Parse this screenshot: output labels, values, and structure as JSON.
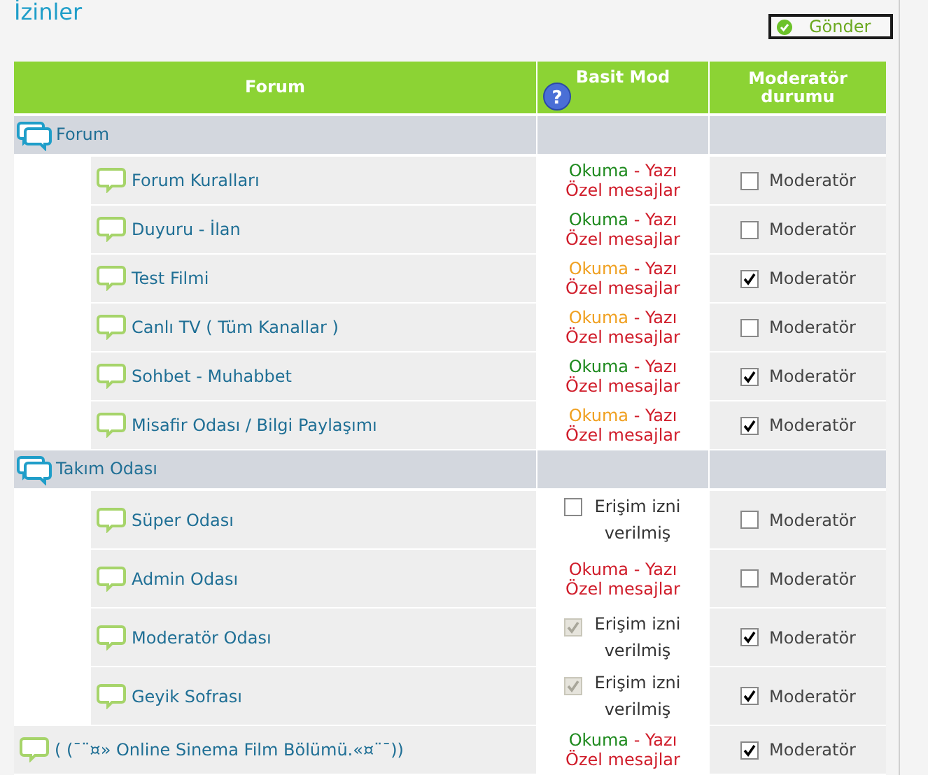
{
  "page_title": "İzinler",
  "submit_button": {
    "label": "Gönder"
  },
  "table": {
    "columns": [
      {
        "label": "Forum"
      },
      {
        "label": "Basit Mod",
        "help": "?"
      },
      {
        "label": "Moderatör durumu"
      }
    ],
    "rows": [
      {
        "kind": "category",
        "name": "Forum",
        "children": [
          {
            "name": "Forum Kuralları",
            "perm": {
              "kind": "rw",
              "read": "Okuma",
              "sep": "-",
              "write": "Yazı",
              "pm": "Özel mesajlar",
              "color": "#1e8a1e"
            },
            "mod": {
              "label": "Moderatör",
              "checked": false
            }
          },
          {
            "name": "Duyuru - İlan",
            "perm": {
              "kind": "rw",
              "read": "Okuma",
              "sep": "-",
              "write": "Yazı",
              "pm": "Özel mesajlar",
              "color": "#1e8a1e"
            },
            "mod": {
              "label": "Moderatör",
              "checked": false
            }
          },
          {
            "name": "Test Filmi",
            "perm": {
              "kind": "rw",
              "read": "Okuma",
              "sep": "-",
              "write": "Yazı",
              "pm": "Özel mesajlar",
              "color": "#f0a020"
            },
            "mod": {
              "label": "Moderatör",
              "checked": true
            }
          },
          {
            "name": "Canlı TV ( Tüm Kanallar )",
            "perm": {
              "kind": "rw",
              "read": "Okuma",
              "sep": "-",
              "write": "Yazı",
              "pm": "Özel mesajlar",
              "color": "#f0a020"
            },
            "mod": {
              "label": "Moderatör",
              "checked": false
            }
          },
          {
            "name": "Sohbet - Muhabbet",
            "perm": {
              "kind": "rw",
              "read": "Okuma",
              "sep": "-",
              "write": "Yazı",
              "pm": "Özel mesajlar",
              "color": "#1e8a1e"
            },
            "mod": {
              "label": "Moderatör",
              "checked": true
            }
          },
          {
            "name": "Misafir Odası / Bilgi Paylaşımı",
            "perm": {
              "kind": "rw",
              "read": "Okuma",
              "sep": "-",
              "write": "Yazı",
              "pm": "Özel mesajlar",
              "color": "#f0a020"
            },
            "mod": {
              "label": "Moderatör",
              "checked": true
            }
          }
        ]
      },
      {
        "kind": "category",
        "name": "Takım Odası",
        "children": [
          {
            "name": "Süper Odası",
            "perm": {
              "kind": "access",
              "label": "Erişim izni verilmiş",
              "checked": false,
              "disabled": false
            },
            "mod": {
              "label": "Moderatör",
              "checked": false
            }
          },
          {
            "name": "Admin Odası",
            "perm": {
              "kind": "rw",
              "read": "Okuma",
              "sep": "-",
              "write": "Yazı",
              "pm": "Özel mesajlar",
              "color": "#d01c2a"
            },
            "mod": {
              "label": "Moderatör",
              "checked": false
            }
          },
          {
            "name": "Moderatör Odası",
            "perm": {
              "kind": "access",
              "label": "Erişim izni verilmiş",
              "checked": true,
              "disabled": true
            },
            "mod": {
              "label": "Moderatör",
              "checked": true
            }
          },
          {
            "name": "Geyik Sofrası",
            "perm": {
              "kind": "access",
              "label": "Erişim izni verilmiş",
              "checked": true,
              "disabled": true
            },
            "mod": {
              "label": "Moderatör",
              "checked": true
            }
          }
        ]
      },
      {
        "kind": "forum",
        "name": "( (¯¨¤» Online Sinema Film Bölümü.«¤¨¯))",
        "perm": {
          "kind": "rw",
          "read": "Okuma",
          "sep": "-",
          "write": "Yazı",
          "pm": "Özel mesajlar",
          "color": "#1e8a1e"
        },
        "mod": {
          "label": "Moderatör",
          "checked": true
        }
      }
    ]
  }
}
